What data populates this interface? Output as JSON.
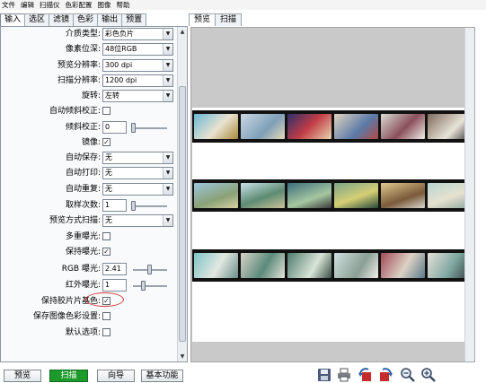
{
  "menu": [
    "文件",
    "编辑",
    "扫描仪",
    "色彩配置",
    "图像",
    "帮助"
  ],
  "left_tabs": [
    {
      "label": "输入",
      "active": true
    },
    {
      "label": "选区",
      "active": false
    },
    {
      "label": "滤镜",
      "active": false
    },
    {
      "label": "色彩",
      "active": false
    },
    {
      "label": "输出",
      "active": false
    },
    {
      "label": "预置",
      "active": false
    }
  ],
  "settings": {
    "media_type": {
      "label": "介质类型:",
      "value": "彩色负片"
    },
    "bit_depth": {
      "label": "像素位深:",
      "value": "48位RGB"
    },
    "preview_res": {
      "label": "预览分辨率:",
      "value": "300 dpi"
    },
    "scan_res": {
      "label": "扫描分辨率:",
      "value": "1200 dpi"
    },
    "rotate": {
      "label": "旋转:",
      "value": "左转"
    },
    "auto_skew": {
      "label": "自动倾斜校正:",
      "checked": false
    },
    "skew": {
      "label": "倾斜校正:",
      "value": "0"
    },
    "mirror": {
      "label": "镜像:",
      "checked": true
    },
    "auto_save": {
      "label": "自动保存:",
      "value": "无"
    },
    "auto_print": {
      "label": "自动打印:",
      "value": "无"
    },
    "auto_repeat": {
      "label": "自动重复:",
      "value": "无"
    },
    "samples": {
      "label": "取样次数:",
      "value": "1"
    },
    "preview_mode": {
      "label": "预览方式扫描:",
      "value": "无"
    },
    "multi_exposure": {
      "label": "多重曝光:",
      "checked": false
    },
    "keep_exposure": {
      "label": "保持曝光:",
      "checked": true
    },
    "rgb_exposure": {
      "label": "RGB 曝光:",
      "value": "2.41"
    },
    "red_exposure": {
      "label": "红外曝光:",
      "value": "1"
    },
    "keep_film_base": {
      "label": "保持胶片片基色:",
      "checked": true
    },
    "save_color_settings": {
      "label": "保存图像色彩设置:",
      "checked": false
    },
    "default_options": {
      "label": "默认选项:",
      "checked": false
    }
  },
  "buttons": {
    "preview": "预览",
    "scan": "扫描",
    "guide": "向导",
    "basic": "基本功能"
  },
  "right_tabs": [
    {
      "label": "预览",
      "active": true
    },
    {
      "label": "扫描",
      "active": false
    }
  ],
  "toolbar_icons": [
    "save-icon",
    "print-icon",
    "rotate-left-icon",
    "rotate-right-icon",
    "zoom-out-icon",
    "zoom-in-icon"
  ],
  "check_mark": "✓",
  "dropdown_arrow": "▼",
  "colors": {
    "scan_button": "#1c9a2c",
    "highlight_circle": "#d23a3a",
    "preview_bg": "#c9c9c9"
  }
}
